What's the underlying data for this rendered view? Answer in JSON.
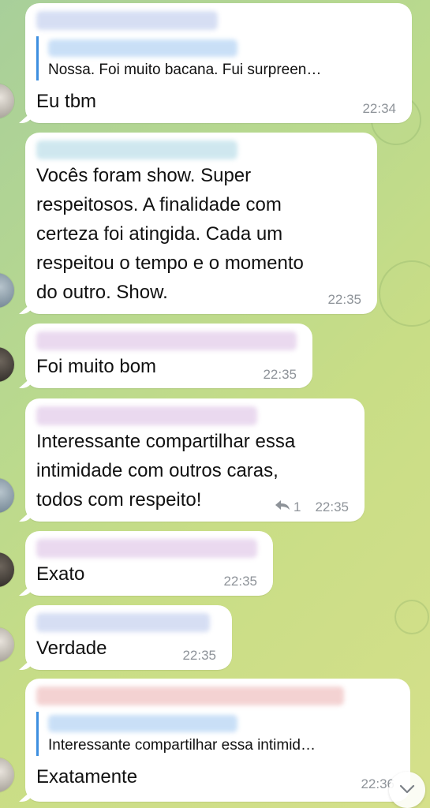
{
  "messages": [
    {
      "reply_text": "Nossa. Foi muito bacana. Fui surpreen…",
      "text": "Eu tbm",
      "time": "22:34"
    },
    {
      "text_lines": [
        "Vocês foram show. Super",
        "respeitosos. A finalidade com",
        "certeza foi atingida. Cada um",
        "respeitou o tempo e o momento",
        "do outro. Show."
      ],
      "time": "22:35"
    },
    {
      "text": "Foi muito bom",
      "time": "22:35"
    },
    {
      "text_lines": [
        "Interessante compartilhar essa",
        "intimidade com outros caras,",
        "todos com respeito!"
      ],
      "reply_count": "1",
      "time": "22:35"
    },
    {
      "text": "Exato",
      "time": "22:35"
    },
    {
      "text": "Verdade",
      "time": "22:35"
    },
    {
      "reply_text": "Interessante compartilhar essa intimid…",
      "text": "Exatamente",
      "time": "22:36"
    }
  ],
  "icons": {
    "reply": "reply-arrow-icon",
    "scroll": "chevron-down-icon"
  },
  "colors": {
    "accent": "#3d8fe0",
    "bubble": "#ffffff"
  }
}
